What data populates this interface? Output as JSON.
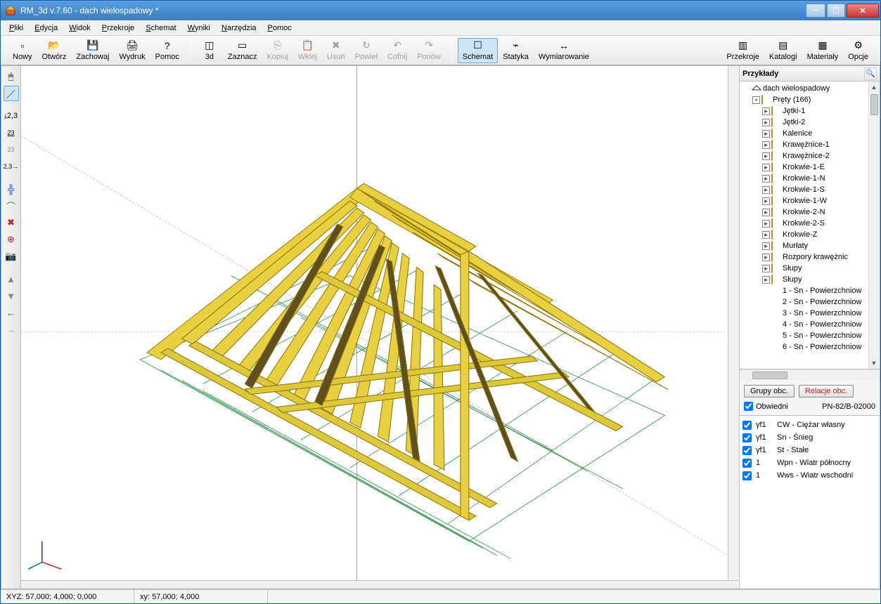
{
  "window": {
    "title": "RM_3d v.7.60 - dach wielospadowy *"
  },
  "menu": [
    "Pliki",
    "Edycja",
    "Widok",
    "Przekroje",
    "Schemat",
    "Wyniki",
    "Narzędzia",
    "Pomoc"
  ],
  "toolbar": {
    "g1": [
      {
        "id": "nowy",
        "label": "Nowy",
        "ico": "▫"
      },
      {
        "id": "otworz",
        "label": "Otwórz",
        "ico": "📂"
      },
      {
        "id": "zachowaj",
        "label": "Zachowaj",
        "ico": "💾"
      },
      {
        "id": "wydruk",
        "label": "Wydruk",
        "ico": "🖨"
      },
      {
        "id": "pomoc",
        "label": "Pomoc",
        "ico": "?"
      }
    ],
    "g2": [
      {
        "id": "3d",
        "label": "3d",
        "ico": "◫"
      },
      {
        "id": "zaznacz",
        "label": "Zaznacz",
        "ico": "▭"
      },
      {
        "id": "kopiuj",
        "label": "Kopiuj",
        "ico": "⎘",
        "dis": true
      },
      {
        "id": "wklej",
        "label": "Wklej",
        "ico": "📋",
        "dis": true
      },
      {
        "id": "usun",
        "label": "Usuń",
        "ico": "✖",
        "dis": true
      },
      {
        "id": "powiel",
        "label": "Powiel",
        "ico": "↻",
        "dis": true
      },
      {
        "id": "cofnij",
        "label": "Cofnij",
        "ico": "↶",
        "dis": true
      },
      {
        "id": "ponow",
        "label": "Ponów",
        "ico": "↷",
        "dis": true
      }
    ],
    "g3": [
      {
        "id": "schemat",
        "label": "Schemat",
        "ico": "☐",
        "active": true
      },
      {
        "id": "statyka",
        "label": "Statyka",
        "ico": "⌁"
      },
      {
        "id": "wymiarowanie",
        "label": "Wymiarowanie",
        "ico": "↔"
      }
    ],
    "g4": [
      {
        "id": "przekroje",
        "label": "Przekroje",
        "ico": "▥"
      },
      {
        "id": "katalogi",
        "label": "Katalogi",
        "ico": "▤"
      },
      {
        "id": "materialy",
        "label": "Materiały",
        "ico": "▦"
      },
      {
        "id": "opcje",
        "label": "Opcje",
        "ico": "⚙"
      }
    ]
  },
  "sidepanel": {
    "title": "Przykłady",
    "root": "dach wielospadowy",
    "group": "Pręty (166)",
    "folders": [
      "Jętki-1",
      "Jętki-2",
      "Kalenice",
      "Krawężnice-1",
      "Krawężnice-2",
      "Krokwie-1-E",
      "Krokwie-1-N",
      "Krokwie-1-S",
      "Krokwie-1-W",
      "Krokwie-2-N",
      "Krokwie-2-S",
      "Krokwie-Z",
      "Murłaty",
      "Rozpory krawężnic",
      "Słupy",
      "Słupy"
    ],
    "loads": [
      "1 - Sn - Powierzchniow",
      "2 - Sn - Powierzchniow",
      "3 - Sn - Powierzchniow",
      "4 - Sn - Powierzchniow",
      "5 - Sn - Powierzchniow",
      "6 - Sn - Powierzchniow"
    ]
  },
  "midpanel": {
    "btn1": "Grupy obc.",
    "btn2": "Relacje obc.",
    "chk": "Obwiedni",
    "norm": "PN-82/B-02000"
  },
  "loadlist": [
    {
      "f": "γf1",
      "name": "CW - Ciężar własny"
    },
    {
      "f": "γf1",
      "name": "Sn - Śnieg"
    },
    {
      "f": "γf1",
      "name": "St - Stałe"
    },
    {
      "f": "1",
      "name": "Wpn - Wiatr północny"
    },
    {
      "f": "1",
      "name": "Wws - Wiatr wschodni"
    }
  ],
  "status": {
    "xyz": "XYZ: 57,000; 4,000; 0,000",
    "xy": "xy: 57,000; 4,000"
  }
}
